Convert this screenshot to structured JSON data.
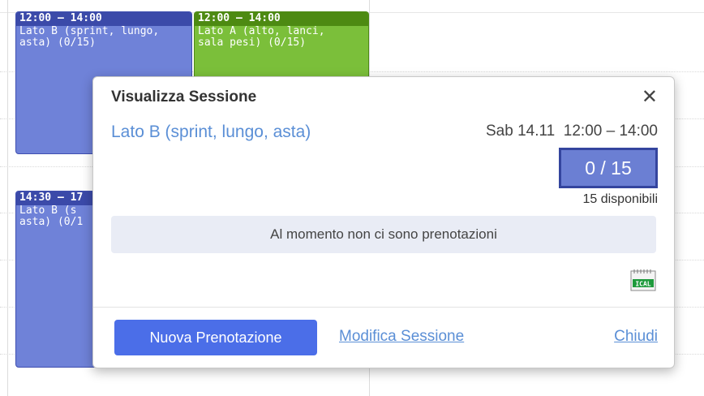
{
  "calendar": {
    "events": [
      {
        "time": "12:00 – 14:00",
        "title": "Lato B (sprint, lungo,\nasta) (0/15)",
        "color": "#6f82d8"
      },
      {
        "time": "12:00 – 14:00",
        "title": "Lato A (alto, lanci,\nsala pesi) (0/15)",
        "color": "#7bbf3a"
      },
      {
        "time": "14:30 – 17",
        "title": "Lato B (s\nasta) (0/1",
        "color": "#6f82d8"
      }
    ]
  },
  "popup": {
    "title": "Visualizza Sessione",
    "close_glyph": "✕",
    "session_name": "Lato B (sprint, lungo, asta)",
    "session_date": "Sab 14.11  12:00 – 14:00",
    "capacity": "0 / 15",
    "available": "15 disponibili",
    "notice": "Al momento non ci sono prenotazioni",
    "ical_icon": "ical-icon",
    "ical_label": "ICAL",
    "new_booking_label": "Nuova Prenotazione",
    "edit_session_label": "Modifica Sessione",
    "close_label": "Chiudi"
  },
  "colors": {
    "accent": "#4b6ee8",
    "link": "#5b8fd6",
    "capacity_fill": "#6b7fd3"
  }
}
